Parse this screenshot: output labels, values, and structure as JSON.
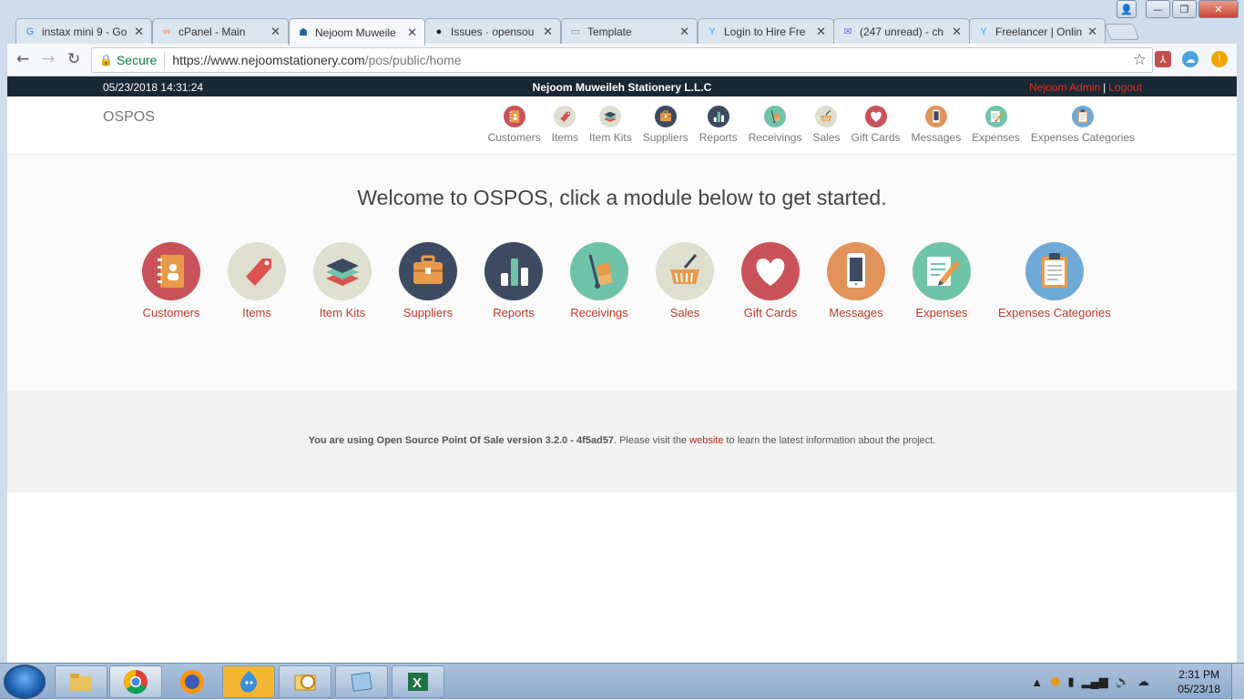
{
  "window": {
    "minimize": "—",
    "maximize": "❐",
    "close": "✕"
  },
  "tabs": [
    {
      "title": "instax mini 9 - Go",
      "icon_color": "#4285f4",
      "icon_glyph": "G"
    },
    {
      "title": "cPanel - Main",
      "icon_color": "#ff6c2c",
      "icon_glyph": "∞"
    },
    {
      "title": "Nejoom Muweile",
      "icon_color": "#1a5fa8",
      "icon_glyph": "☗"
    },
    {
      "title": "Issues · opensou",
      "icon_color": "#222222",
      "icon_glyph": "●"
    },
    {
      "title": "Template",
      "icon_color": "#888888",
      "icon_glyph": "▭"
    },
    {
      "title": "Login to Hire Fre",
      "icon_color": "#29b2fe",
      "icon_glyph": "Y"
    },
    {
      "title": "(247 unread) - ch",
      "icon_color": "#7b68ee",
      "icon_glyph": "✉"
    },
    {
      "title": "Freelancer | Onlin",
      "icon_color": "#29b2fe",
      "icon_glyph": "Y"
    }
  ],
  "browser": {
    "back": "←",
    "forward": "→",
    "reload": "↻",
    "secure_label": "Secure",
    "url_host": "https://www.nejoomstationery.com",
    "url_path": "/pos/public/home",
    "star": "☆"
  },
  "topbar": {
    "datetime": "05/23/2018 14:31:24",
    "company": "Nejoom Muweileh Stationery L.L.C",
    "user": "Nejoom Admin",
    "separator": "|",
    "logout": "Logout"
  },
  "brand": "OSPOS",
  "modules": [
    {
      "key": "customers",
      "label": "Customers",
      "color": "#c9525a",
      "icon": "address-book-icon"
    },
    {
      "key": "items",
      "label": "Items",
      "color": "#dfdfd0",
      "icon": "tag-icon"
    },
    {
      "key": "item-kits",
      "label": "Item Kits",
      "color": "#dfdfd0",
      "icon": "layers-icon"
    },
    {
      "key": "suppliers",
      "label": "Suppliers",
      "color": "#3e4a61",
      "icon": "briefcase-icon"
    },
    {
      "key": "reports",
      "label": "Reports",
      "color": "#3e4a61",
      "icon": "bar-chart-icon"
    },
    {
      "key": "receivings",
      "label": "Receivings",
      "color": "#6fc3a8",
      "icon": "hand-truck-icon"
    },
    {
      "key": "sales",
      "label": "Sales",
      "color": "#dfdfd0",
      "icon": "basket-icon"
    },
    {
      "key": "gift-cards",
      "label": "Gift Cards",
      "color": "#c9525a",
      "icon": "heart-icon"
    },
    {
      "key": "messages",
      "label": "Messages",
      "color": "#e2935a",
      "icon": "phone-icon"
    },
    {
      "key": "expenses",
      "label": "Expenses",
      "color": "#6fc3a8",
      "icon": "notepad-pencil-icon"
    },
    {
      "key": "expenses-categories",
      "label": "Expenses Categories",
      "color": "#6fa9d6",
      "icon": "clipboard-icon"
    }
  ],
  "welcome": "Welcome to OSPOS, click a module below to get started.",
  "footer": {
    "bold": "You are using Open Source Point Of Sale version 3.2.0 - 4f5ad57",
    "pre_link": ". Please visit the ",
    "link": "website",
    "post_link": " to learn the latest information about the project."
  },
  "taskbar": {
    "time": "2:31 PM",
    "date": "05/23/18"
  }
}
